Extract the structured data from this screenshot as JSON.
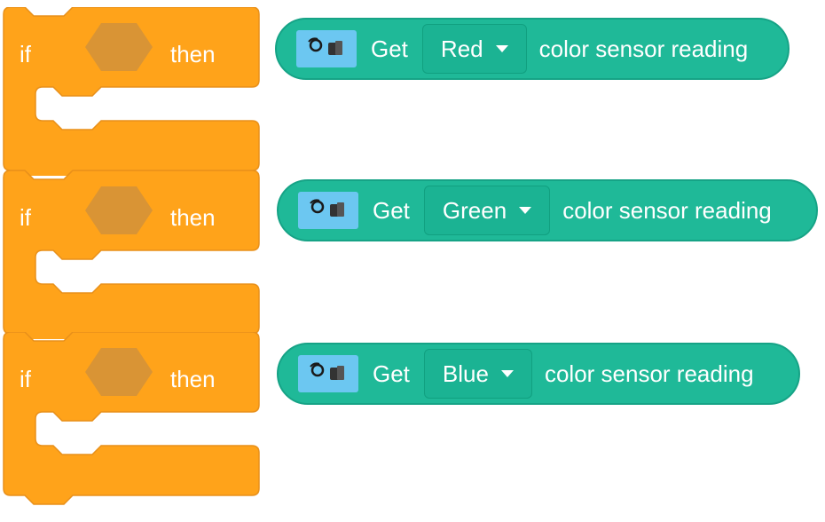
{
  "if_blocks": [
    {
      "if_label": "if",
      "then_label": "then"
    },
    {
      "if_label": "if",
      "then_label": "then"
    },
    {
      "if_label": "if",
      "then_label": "then"
    }
  ],
  "reporters": [
    {
      "icon": "color-sensor-icon",
      "get_label": "Get",
      "color_value": "Red",
      "suffix_label": "color sensor reading"
    },
    {
      "icon": "color-sensor-icon",
      "get_label": "Get",
      "color_value": "Green",
      "suffix_label": "color sensor reading"
    },
    {
      "icon": "color-sensor-icon",
      "get_label": "Get",
      "color_value": "Blue",
      "suffix_label": "color sensor reading"
    }
  ],
  "colors": {
    "control_block": "#ffa31a",
    "control_block_border": "#e8901a",
    "condition_slot": "#d99435",
    "sensing_block": "#1fb998",
    "icon_background": "#6cc7f1"
  }
}
